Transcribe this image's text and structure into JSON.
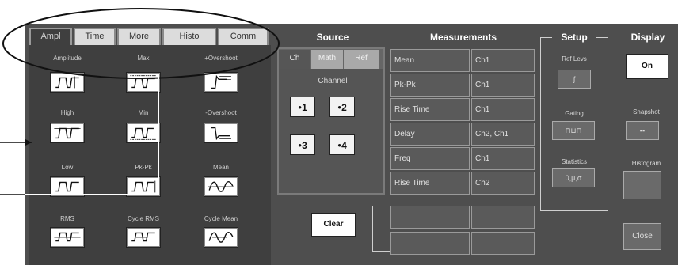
{
  "tabs": [
    "Ampl",
    "Time",
    "More",
    "Histo",
    "Comm"
  ],
  "measurements_grid": [
    {
      "label": "Amplitude",
      "icon": "amplitude-waveform-icon"
    },
    {
      "label": "Max",
      "icon": "max-waveform-icon"
    },
    {
      "label": "+Overshoot",
      "icon": "positive-overshoot-waveform-icon"
    },
    {
      "label": "High",
      "icon": "high-waveform-icon"
    },
    {
      "label": "Min",
      "icon": "min-waveform-icon"
    },
    {
      "label": "-Overshoot",
      "icon": "negative-overshoot-waveform-icon"
    },
    {
      "label": "Low",
      "icon": "low-waveform-icon"
    },
    {
      "label": "Pk-Pk",
      "icon": "pk-pk-waveform-icon"
    },
    {
      "label": "Mean",
      "icon": "mean-waveform-icon"
    },
    {
      "label": "RMS",
      "icon": "rms-waveform-icon"
    },
    {
      "label": "Cycle RMS",
      "icon": "cycle-rms-waveform-icon"
    },
    {
      "label": "Cycle Mean",
      "icon": "cycle-mean-waveform-icon"
    }
  ],
  "source": {
    "title": "Source",
    "tabs": [
      "Ch",
      "Math",
      "Ref"
    ],
    "channel_label": "Channel",
    "channels": [
      "1",
      "2",
      "3",
      "4"
    ]
  },
  "measurements": {
    "title": "Measurements",
    "rows": [
      {
        "name": "Mean",
        "source": "Ch1"
      },
      {
        "name": "Pk-Pk",
        "source": "Ch1"
      },
      {
        "name": "Rise Time",
        "source": "Ch1"
      },
      {
        "name": "Delay",
        "source": "Ch2, Ch1"
      },
      {
        "name": "Freq",
        "source": "Ch1"
      },
      {
        "name": "Rise Time",
        "source": "Ch2"
      },
      {
        "name": "",
        "source": ""
      },
      {
        "name": "",
        "source": ""
      }
    ],
    "clear_label": "Clear"
  },
  "setup": {
    "title": "Setup",
    "ref_levs_label": "Ref Levs",
    "gating_label": "Gating",
    "statistics_label": "Statistics",
    "statistics_value": "0,μ,σ"
  },
  "display": {
    "title": "Display",
    "on_label": "On",
    "snapshot_label": "Snapshot",
    "histogram_label": "Histogram",
    "close_label": "Close"
  },
  "colors": {
    "panel": "#4e4e4e",
    "dark": "#3f3f3f",
    "button": "#ffffff"
  }
}
